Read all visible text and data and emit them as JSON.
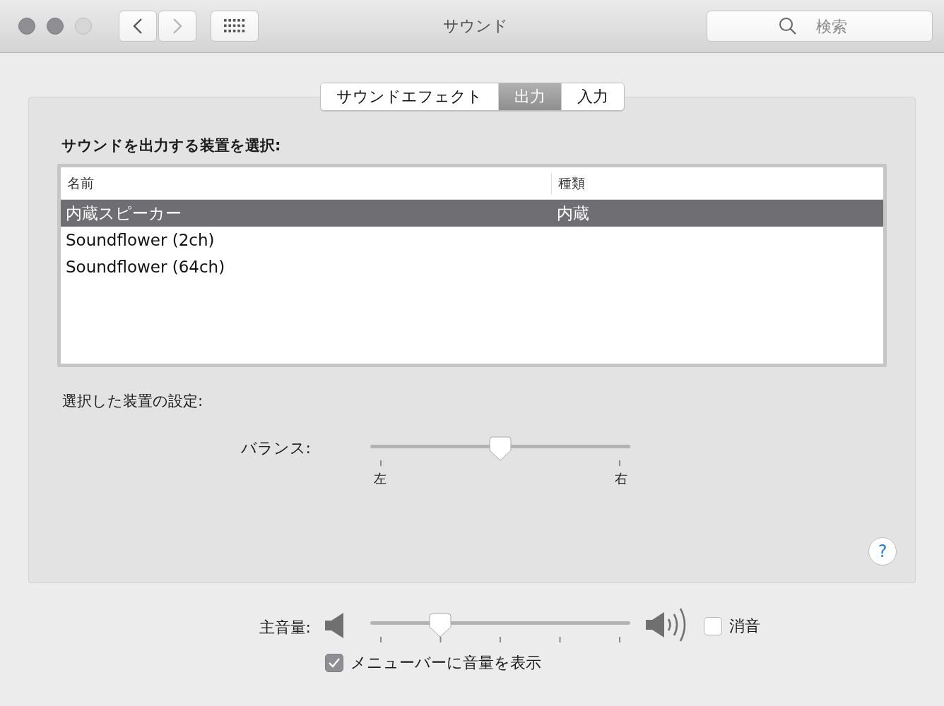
{
  "window": {
    "title": "サウンド"
  },
  "search": {
    "placeholder": "検索"
  },
  "tabs": [
    {
      "label": "サウンドエフェクト",
      "selected": false
    },
    {
      "label": "出力",
      "selected": true
    },
    {
      "label": "入力",
      "selected": false
    }
  ],
  "device_list": {
    "heading": "サウンドを出力する装置を選択:",
    "columns": [
      "名前",
      "種類"
    ],
    "rows": [
      {
        "name": "内蔵スピーカー",
        "type": "内蔵",
        "selected": true
      },
      {
        "name": "Soundflower (2ch)",
        "selected": false
      },
      {
        "name": "Soundflower (64ch)",
        "selected": false
      }
    ]
  },
  "settings_label": "選択した装置の設定:",
  "balance": {
    "label": "バランス:",
    "level": 0.5,
    "min_label": "左",
    "max_label": "右"
  },
  "volume": {
    "label": "主音量:",
    "level": 0.27,
    "mute": {
      "label": "消音",
      "checked": false
    }
  },
  "menu_bar_option": {
    "label": "メニューバーに音量を表示",
    "checked": true
  },
  "help_button": "?"
}
